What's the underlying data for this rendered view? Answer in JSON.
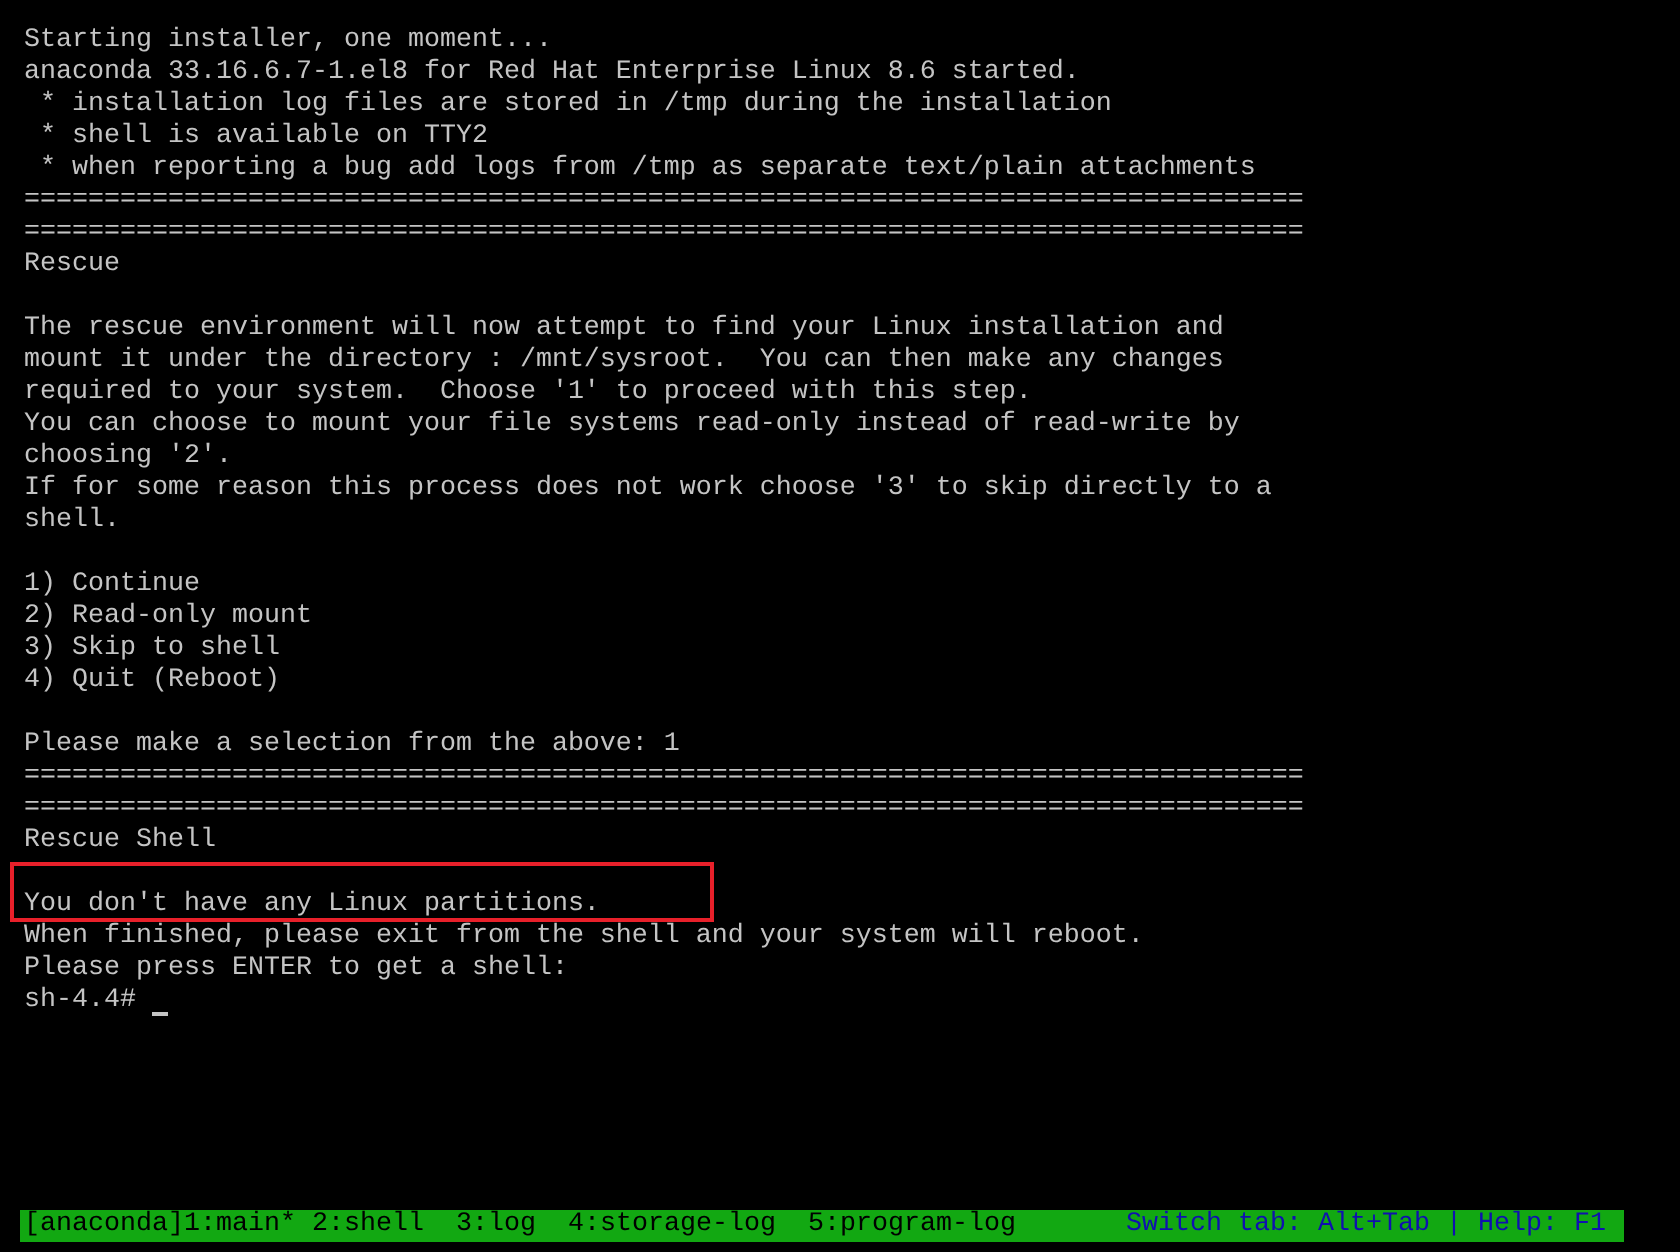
{
  "console_lines": [
    {
      "kind": "text",
      "text": "Starting installer, one moment..."
    },
    {
      "kind": "text",
      "text": "anaconda 33.16.6.7-1.el8 for Red Hat Enterprise Linux 8.6 started."
    },
    {
      "kind": "text",
      "text": " * installation log files are stored in /tmp during the installation"
    },
    {
      "kind": "text",
      "text": " * shell is available on TTY2"
    },
    {
      "kind": "text",
      "text": " * when reporting a bug add logs from /tmp as separate text/plain attachments"
    },
    {
      "kind": "rule",
      "text": "================================================================================"
    },
    {
      "kind": "rule",
      "text": "================================================================================"
    },
    {
      "kind": "text",
      "text": "Rescue"
    },
    {
      "kind": "blank"
    },
    {
      "kind": "text",
      "text": "The rescue environment will now attempt to find your Linux installation and"
    },
    {
      "kind": "text",
      "text": "mount it under the directory : /mnt/sysroot.  You can then make any changes"
    },
    {
      "kind": "text",
      "text": "required to your system.  Choose '1' to proceed with this step."
    },
    {
      "kind": "text",
      "text": "You can choose to mount your file systems read-only instead of read-write by"
    },
    {
      "kind": "text",
      "text": "choosing '2'."
    },
    {
      "kind": "text",
      "text": "If for some reason this process does not work choose '3' to skip directly to a"
    },
    {
      "kind": "text",
      "text": "shell."
    },
    {
      "kind": "blank"
    },
    {
      "kind": "option",
      "text": "1) Continue"
    },
    {
      "kind": "option",
      "text": "2) Read-only mount"
    },
    {
      "kind": "option",
      "text": "3) Skip to shell"
    },
    {
      "kind": "option",
      "text": "4) Quit (Reboot)"
    },
    {
      "kind": "blank"
    },
    {
      "kind": "text",
      "text": "Please make a selection from the above: 1"
    },
    {
      "kind": "rule",
      "text": "================================================================================"
    },
    {
      "kind": "rule",
      "text": "================================================================================"
    },
    {
      "kind": "text",
      "text": "Rescue Shell"
    },
    {
      "kind": "blank"
    },
    {
      "kind": "text",
      "text": "You don't have any Linux partitions.",
      "highlighted": true
    },
    {
      "kind": "text",
      "text": "When finished, please exit from the shell and your system will reboot."
    },
    {
      "kind": "text",
      "text": "Please press ENTER to get a shell:"
    },
    {
      "kind": "prompt",
      "text": "sh-4.4#"
    }
  ],
  "status_bar": {
    "tabs": [
      "[anaconda]1:main*",
      "2:shell",
      "3:log",
      "4:storage-log",
      "5:program-log"
    ],
    "hint": "Switch tab: Alt+Tab | Help: F1"
  }
}
